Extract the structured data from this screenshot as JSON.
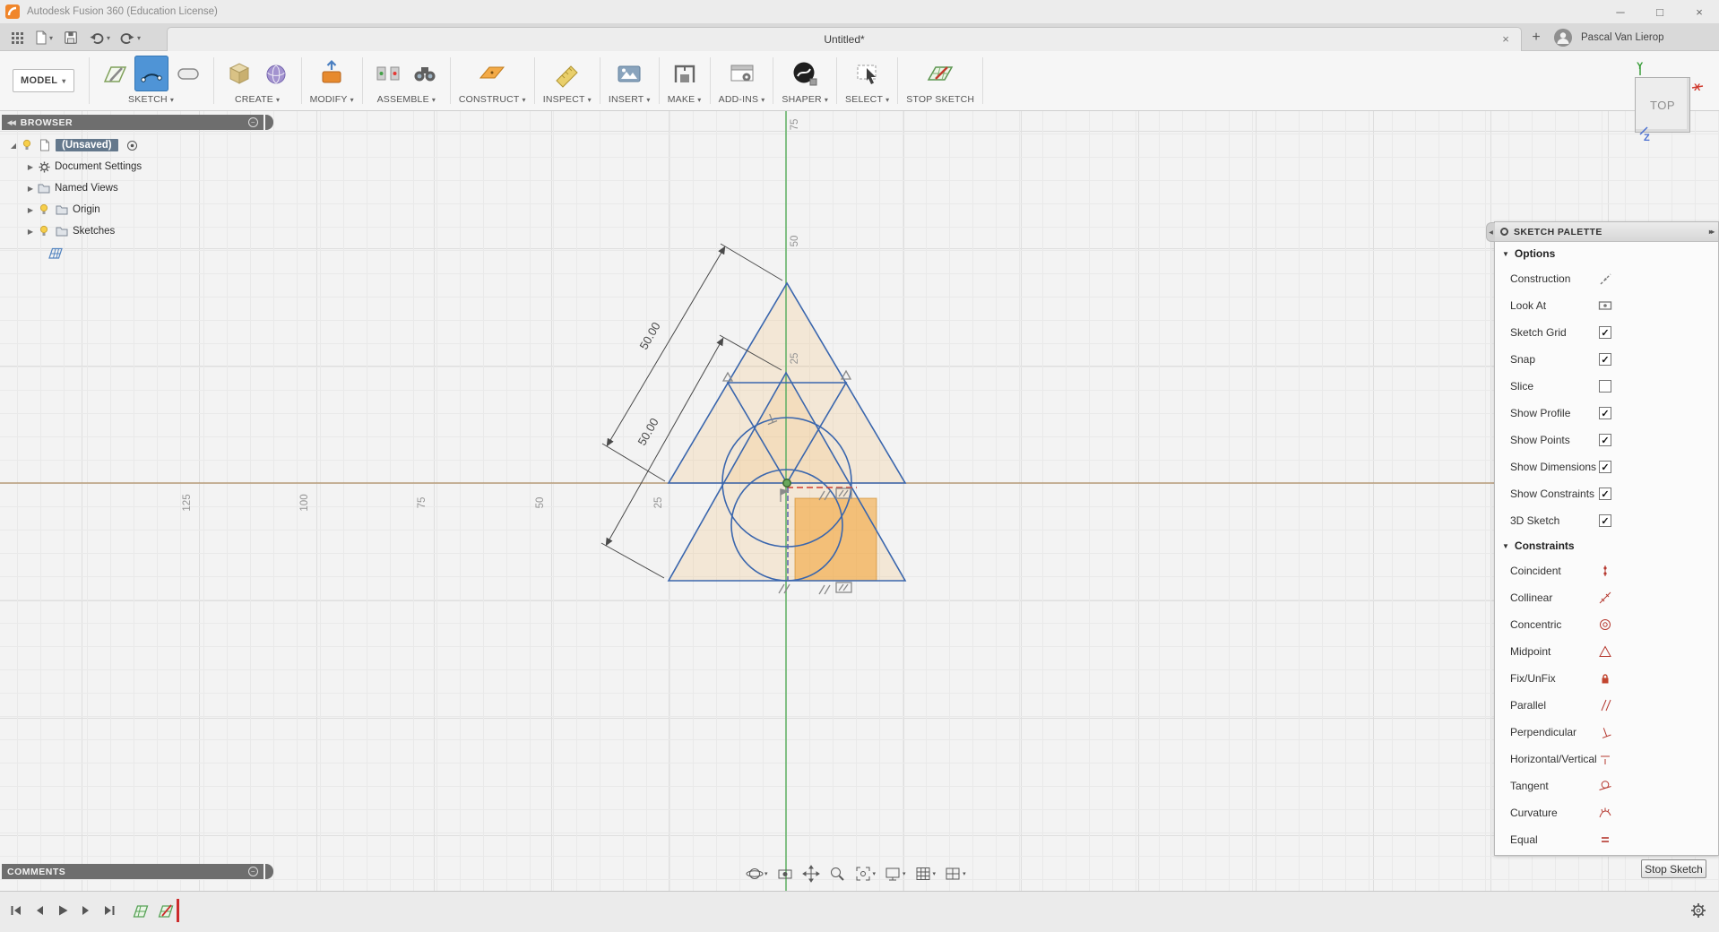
{
  "glyphs": {
    "caret_down": "▾",
    "section_arrow": "▼",
    "tree_collapsed": "▶",
    "tree_expanded": "◢",
    "collapse_left": "◀",
    "collapse_left_double": "◀◀",
    "expand_right_double": "▸▸",
    "minimize": "─",
    "maximize": "□",
    "close": "×",
    "plus": "+",
    "minus": "−"
  },
  "colors": {
    "sketch_line": "#3a66ad",
    "profile_fill": "#f4b054",
    "selected_profile": "#f29e2c",
    "axis_y_green": "#66b36a",
    "axis_x_brown": "#ad8a62",
    "active_tool_blue": "#4f94d6",
    "constraint_red": "#b5382f"
  },
  "titlebar": {
    "app_title": "Autodesk Fusion 360 (Education License)"
  },
  "tabbar": {
    "document_tab": "Untitled*",
    "user_name": "Pascal Van Lierop"
  },
  "toolbar": {
    "workspace_label": "MODEL",
    "groups": [
      {
        "label": "SKETCH"
      },
      {
        "label": "CREATE"
      },
      {
        "label": "MODIFY"
      },
      {
        "label": "ASSEMBLE"
      },
      {
        "label": "CONSTRUCT"
      },
      {
        "label": "INSPECT"
      },
      {
        "label": "INSERT"
      },
      {
        "label": "MAKE"
      },
      {
        "label": "ADD-INS"
      },
      {
        "label": "SHAPER"
      },
      {
        "label": "SELECT"
      },
      {
        "label": "STOP SKETCH"
      }
    ]
  },
  "browser": {
    "title": "BROWSER",
    "root_label": "(Unsaved)",
    "items": [
      {
        "label": "Document Settings"
      },
      {
        "label": "Named Views"
      },
      {
        "label": "Origin"
      },
      {
        "label": "Sketches"
      }
    ]
  },
  "viewcube": {
    "face_label": "TOP",
    "axis_x": "X",
    "axis_y": "Y",
    "axis_z": "Z"
  },
  "canvas": {
    "dimension_1": "50.00",
    "dimension_2": "50.00",
    "v_ruler": [
      "75",
      "50",
      "25"
    ],
    "h_ruler": [
      "125",
      "100",
      "75",
      "50",
      "25"
    ]
  },
  "palette": {
    "title": "SKETCH PALETTE",
    "options_header": "Options",
    "constraints_header": "Constraints",
    "options": [
      {
        "label": "Construction"
      },
      {
        "label": "Look At"
      },
      {
        "label": "Sketch Grid",
        "checked": true
      },
      {
        "label": "Snap",
        "checked": true
      },
      {
        "label": "Slice",
        "checked": false
      },
      {
        "label": "Show Profile",
        "checked": true
      },
      {
        "label": "Show Points",
        "checked": true
      },
      {
        "label": "Show Dimensions",
        "checked": true
      },
      {
        "label": "Show Constraints",
        "checked": true
      },
      {
        "label": "3D Sketch",
        "checked": true
      }
    ],
    "constraints": [
      {
        "label": "Coincident"
      },
      {
        "label": "Collinear"
      },
      {
        "label": "Concentric"
      },
      {
        "label": "Midpoint"
      },
      {
        "label": "Fix/UnFix"
      },
      {
        "label": "Parallel"
      },
      {
        "label": "Perpendicular"
      },
      {
        "label": "Horizontal/Vertical"
      },
      {
        "label": "Tangent"
      },
      {
        "label": "Curvature"
      },
      {
        "label": "Equal"
      }
    ],
    "stop_sketch_label": "Stop Sketch"
  },
  "comments": {
    "title": "COMMENTS"
  }
}
